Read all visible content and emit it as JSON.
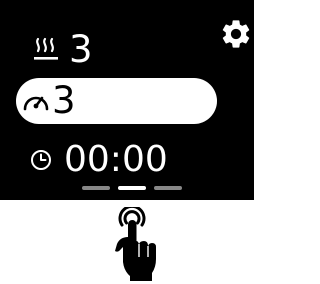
{
  "screen": {
    "settings_icon": "gear-icon",
    "rows": {
      "heat": {
        "icon": "heat-waves-icon",
        "value": "3"
      },
      "power": {
        "icon": "speedometer-icon",
        "value": "3",
        "selected": true
      },
      "timer": {
        "icon": "clock-icon",
        "value": "00:00"
      }
    },
    "pager": {
      "pages": 3,
      "active_index": 1
    }
  },
  "gesture": {
    "icon": "tap-hand-icon"
  },
  "colors": {
    "screen_bg": "#000000",
    "foreground": "#ffffff",
    "selected_bg": "#ffffff",
    "selected_fg": "#000000",
    "pager_inactive": "#888888",
    "pager_active": "#ffffff"
  }
}
